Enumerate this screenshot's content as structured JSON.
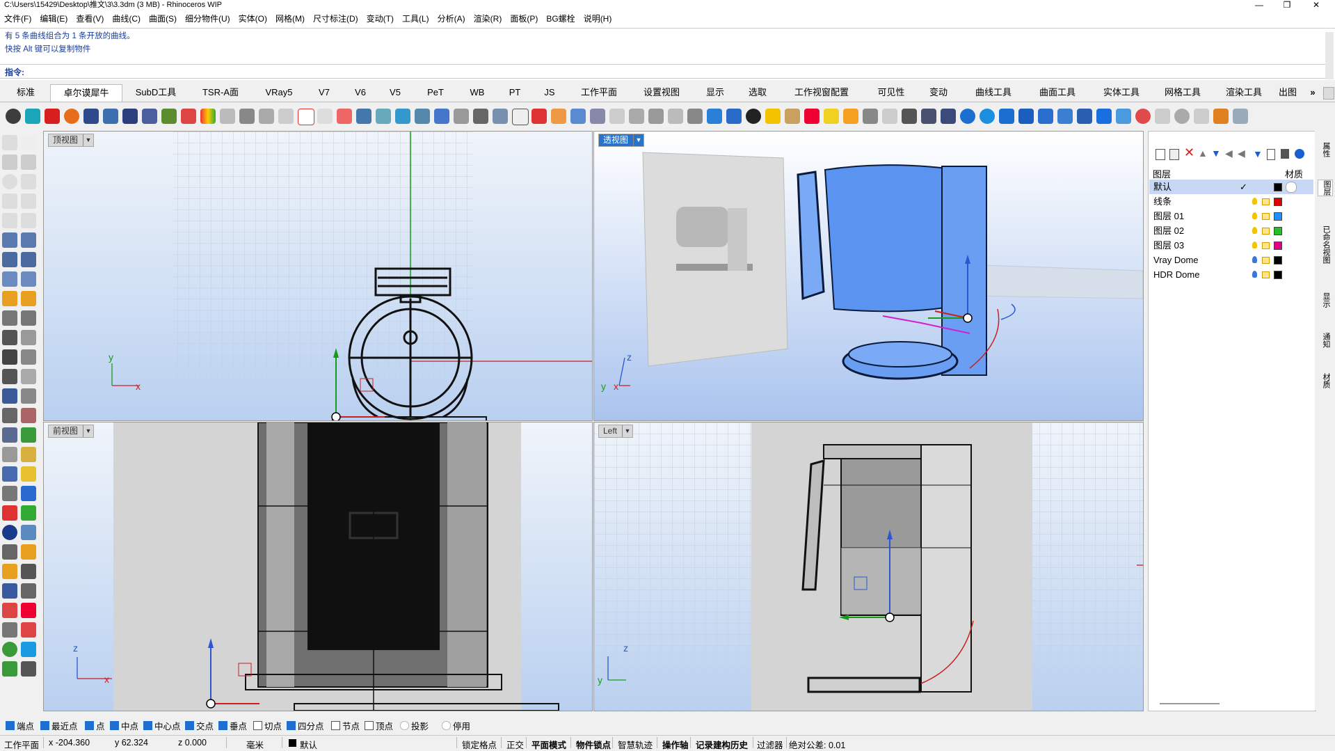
{
  "window": {
    "title": "C:\\Users\\15429\\Desktop\\推文\\3\\3.3dm (3 MB) - Rhinoceros WIP",
    "minimize": "—",
    "maximize": "❐",
    "close": "✕"
  },
  "menu": [
    "文件(F)",
    "编辑(E)",
    "查看(V)",
    "曲线(C)",
    "曲面(S)",
    "细分物件(U)",
    "实体(O)",
    "网格(M)",
    "尺寸标注(D)",
    "变动(T)",
    "工具(L)",
    "分析(A)",
    "渲染(R)",
    "面板(P)",
    "BG螺栓",
    "说明(H)"
  ],
  "command": {
    "history1": "有 5 条曲线组合为 1 条开放的曲线。",
    "history2": "快按 Alt 键可以复制物件",
    "prompt": "指令:"
  },
  "tabs": [
    "标准",
    "卓尔谟犀牛",
    "SubD工具",
    "TSR-A面",
    "VRay5",
    "V7",
    "V6",
    "V5",
    "PeT",
    "WB",
    "PT",
    "JS",
    "工作平面",
    "设置视图",
    "显示",
    "选取",
    "工作视窗配置",
    "可见性",
    "变动",
    "曲线工具",
    "曲面工具",
    "实体工具",
    "网格工具",
    "渲染工具",
    "出图"
  ],
  "tabs_more": "»",
  "active_tab": 1,
  "viewports": {
    "top": {
      "label": "顶视图",
      "axis_x": "x",
      "axis_y": "y"
    },
    "perspective": {
      "label": "透视图",
      "axis_x": "x",
      "axis_y": "y",
      "axis_z": "z"
    },
    "front": {
      "label": "前视图",
      "axis_x": "x",
      "axis_z": "z"
    },
    "left": {
      "label": "Left",
      "axis_y": "y",
      "axis_z": "z"
    }
  },
  "layers": {
    "header": "图层",
    "material_header": "材质",
    "rows": [
      {
        "name": "默认",
        "check": "✓",
        "color": "#000000",
        "selected": true
      },
      {
        "name": "线条",
        "color": "#e00000"
      },
      {
        "name": "图层 01",
        "color": "#1e90ff"
      },
      {
        "name": "图层 02",
        "color": "#22c020"
      },
      {
        "name": "图层 03",
        "color": "#e0008a"
      },
      {
        "name": "Vray Dome",
        "color": "#000000"
      },
      {
        "name": "HDR Dome",
        "color": "#000000"
      }
    ]
  },
  "side_tabs": [
    "属性",
    "图层",
    "已命名视图",
    "显示",
    "通知",
    "材质"
  ],
  "osnaps": [
    {
      "label": "端点",
      "on": true
    },
    {
      "label": "最近点",
      "on": true
    },
    {
      "label": "点",
      "on": true
    },
    {
      "label": "中点",
      "on": true
    },
    {
      "label": "中心点",
      "on": true
    },
    {
      "label": "交点",
      "on": true
    },
    {
      "label": "垂点",
      "on": true
    },
    {
      "label": "切点",
      "on": false
    },
    {
      "label": "四分点",
      "on": true
    },
    {
      "label": "节点",
      "on": false
    },
    {
      "label": "顶点",
      "on": false
    },
    {
      "label": "投影",
      "on": false
    },
    {
      "label": "停用",
      "on": false
    }
  ],
  "status": {
    "cplane": "工作平面",
    "x": "x -204.360",
    "y": "y 62.324",
    "z": "z 0.000",
    "unit": "毫米",
    "layer": "默认",
    "grid_snap": "锁定格点",
    "ortho": "正交",
    "planar": "平面模式",
    "osnap": "物件锁点",
    "smarttrack": "智慧轨迹",
    "gumball": "操作轴",
    "history": "记录建构历史",
    "filter": "过滤器",
    "tolerance": "绝对公差: 0.01"
  }
}
